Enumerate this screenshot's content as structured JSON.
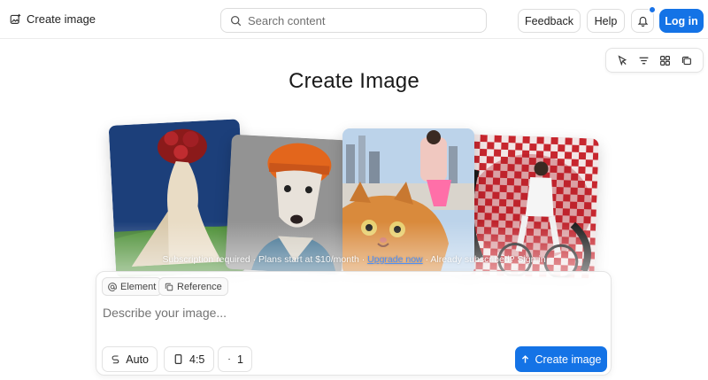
{
  "header": {
    "brand_label": "Create image",
    "brand_icon": "image-sparkle-icon",
    "search_placeholder": "Search content",
    "feedback_label": "Feedback",
    "help_label": "Help",
    "bell_icon": "bell-icon",
    "login_label": "Log in"
  },
  "toolbar": {
    "icons": [
      "select-cursor-icon",
      "filter-lines-icon",
      "grid-view-icon",
      "layers-icon"
    ]
  },
  "page": {
    "title": "Create Image"
  },
  "gallery": {
    "cards": [
      "woman-with-flower-bouquet-image",
      "dog-in-orange-beanie-image",
      "cat-selfie-city-image",
      "woman-on-bicycle-checkered-image"
    ],
    "notice_pre": "Subscription required · Plans start at $10/month · ",
    "notice_link": "Upgrade now",
    "notice_post": " · Already subscribed? Sign in"
  },
  "prompt_panel": {
    "chip_element": "Element",
    "chip_reference": "Reference",
    "placeholder": "Describe your image...",
    "option_auto": "Auto",
    "option_ratio": "4:5",
    "option_count": "1",
    "create_label": "Create image"
  },
  "colors": {
    "accent": "#1473e6",
    "notification_dot": "#1a73e8"
  }
}
